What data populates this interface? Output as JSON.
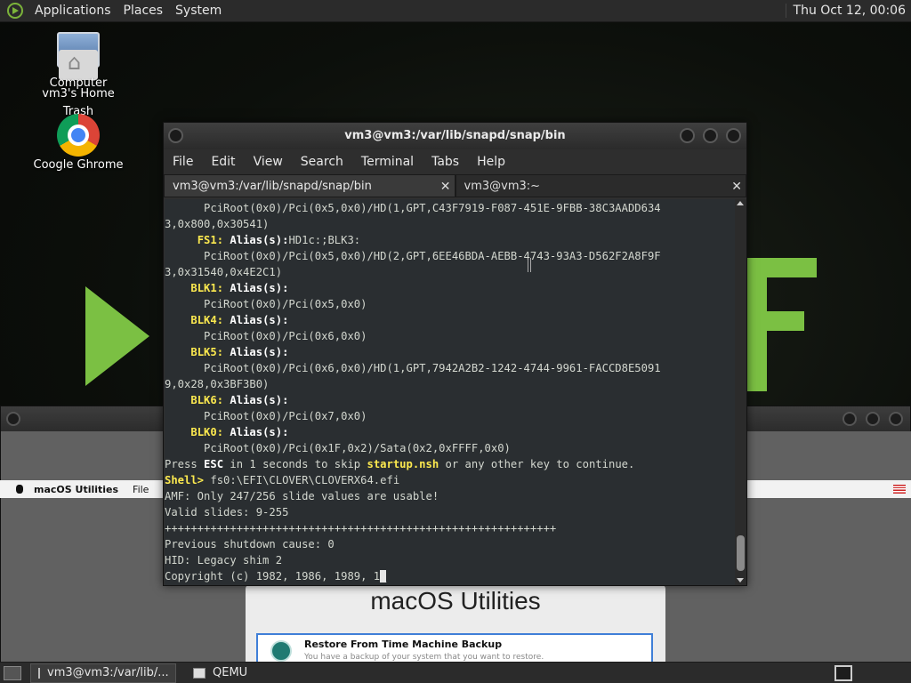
{
  "top_panel": {
    "menus": [
      "Applications",
      "Places",
      "System"
    ],
    "clock": "Thu Oct 12, 00:06"
  },
  "desktop": {
    "icons": [
      {
        "label": "Computer",
        "icon": "computer-icon"
      },
      {
        "label": "vm3's Home",
        "icon": "home-folder-icon"
      },
      {
        "label": "Trash",
        "icon": "trash-icon"
      },
      {
        "label": "Coogle Ghrome",
        "icon": "chrome-icon"
      }
    ]
  },
  "terminal": {
    "title": "vm3@vm3:/var/lib/snapd/snap/bin",
    "menus": [
      "File",
      "Edit",
      "View",
      "Search",
      "Terminal",
      "Tabs",
      "Help"
    ],
    "tabs": [
      {
        "label": "vm3@vm3:/var/lib/snapd/snap/bin",
        "active": true
      },
      {
        "label": "vm3@vm3:~",
        "active": false
      }
    ],
    "lines": [
      "      PciRoot(0x0)/Pci(0x5,0x0)/HD(1,GPT,C43F7919-F087-451E-9FBB-38C3AADD634",
      "3,0x800,0x30541)",
      "     FS1: Alias(s):HD1c:;BLK3:",
      "      PciRoot(0x0)/Pci(0x5,0x0)/HD(2,GPT,6EE46BDA-AEBB-4743-93A3-D562F2A8F9F",
      "3,0x31540,0x4E2C1)",
      "    BLK1: Alias(s):",
      "      PciRoot(0x0)/Pci(0x5,0x0)",
      "    BLK4: Alias(s):",
      "      PciRoot(0x0)/Pci(0x6,0x0)",
      "    BLK5: Alias(s):",
      "      PciRoot(0x0)/Pci(0x6,0x0)/HD(1,GPT,7942A2B2-1242-4744-9961-FACCD8E5091",
      "9,0x28,0x3BF3B0)",
      "    BLK6: Alias(s):",
      "      PciRoot(0x0)/Pci(0x7,0x0)",
      "    BLK0: Alias(s):",
      "      PciRoot(0x0)/Pci(0x1F,0x2)/Sata(0x2,0xFFFF,0x0)",
      "Press ESC in 1 seconds to skip startup.nsh or any other key to continue.",
      "Shell> fs0:\\EFI\\CLOVER\\CLOVERX64.efi",
      "AMF: Only 247/256 slide values are usable!",
      "Valid slides: 9-255",
      "++++++++++++++++++++++++++++++++++++++++++++++++++++++++++++",
      "Previous shutdown cause: 0",
      "HID: Legacy shim 2",
      "Copyright (c) 1982, 1986, 1989, 1"
    ]
  },
  "qemu": {
    "mac_menubar": {
      "app": "macOS Utilities",
      "menu": "File"
    },
    "window_title": "macOS Utilities",
    "option": {
      "title": "Restore From Time Machine Backup",
      "subtitle": "You have a backup of your system that you want to restore."
    }
  },
  "taskbar": {
    "tasks": [
      {
        "label": "vm3@vm3:/var/lib/...",
        "active": true
      },
      {
        "label": "QEMU",
        "active": false
      }
    ]
  }
}
